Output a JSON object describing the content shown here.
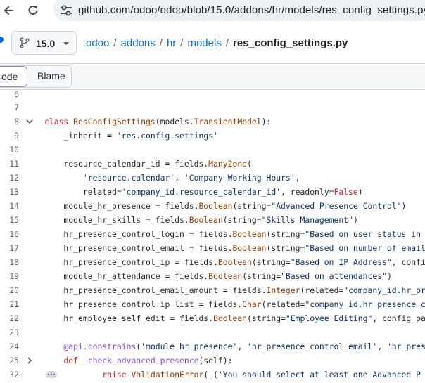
{
  "browser": {
    "url": "github.com/odoo/odoo/blob/15.0/addons/hr/models/res_config_settings.py"
  },
  "repo": {
    "branch": "15.0",
    "breadcrumb": [
      "odoo",
      "addons",
      "hr",
      "models"
    ],
    "separator": "/",
    "current_file": "res_config_settings.py"
  },
  "tabs": {
    "code": "ode",
    "blame": "Blame"
  },
  "code": {
    "lines": [
      {
        "n": "6",
        "segs": []
      },
      {
        "n": "7",
        "segs": []
      },
      {
        "n": "8",
        "segs": [
          [
            "kw",
            "class "
          ],
          [
            "cls",
            "ResConfigSettings"
          ],
          [
            "p",
            "(models."
          ],
          [
            "cls",
            "TransientModel"
          ],
          [
            "p",
            "):"
          ]
        ]
      },
      {
        "n": "9",
        "segs": [
          [
            "p",
            "    _inherit = "
          ],
          [
            "str",
            "'res.config.settings'"
          ]
        ]
      },
      {
        "n": "10",
        "segs": []
      },
      {
        "n": "11",
        "segs": [
          [
            "p",
            "    resource_calendar_id = fields."
          ],
          [
            "cls",
            "Many2one"
          ],
          [
            "p",
            "("
          ]
        ]
      },
      {
        "n": "12",
        "segs": [
          [
            "p",
            "        "
          ],
          [
            "str",
            "'resource.calendar'"
          ],
          [
            "p",
            ", "
          ],
          [
            "str",
            "'Company Working Hours'"
          ],
          [
            "p",
            ","
          ]
        ]
      },
      {
        "n": "13",
        "segs": [
          [
            "p",
            "        related="
          ],
          [
            "str",
            "'company_id.resource_calendar_id'"
          ],
          [
            "p",
            ", readonly="
          ],
          [
            "kw",
            "False"
          ],
          [
            "p",
            ")"
          ]
        ]
      },
      {
        "n": "14",
        "segs": [
          [
            "p",
            "    module_hr_presence = fields."
          ],
          [
            "cls",
            "Boolean"
          ],
          [
            "p",
            "(string="
          ],
          [
            "str",
            "\"Advanced Presence Control\""
          ],
          [
            "p",
            ")"
          ]
        ]
      },
      {
        "n": "15",
        "segs": [
          [
            "p",
            "    module_hr_skills = fields."
          ],
          [
            "cls",
            "Boolean"
          ],
          [
            "p",
            "(string="
          ],
          [
            "str",
            "\"Skills Management\""
          ],
          [
            "p",
            ")"
          ]
        ]
      },
      {
        "n": "16",
        "segs": [
          [
            "p",
            "    hr_presence_control_login = fields."
          ],
          [
            "cls",
            "Boolean"
          ],
          [
            "p",
            "(string="
          ],
          [
            "str",
            "\"Based on user status in sys"
          ]
        ]
      },
      {
        "n": "17",
        "segs": [
          [
            "p",
            "    hr_presence_control_email = fields."
          ],
          [
            "cls",
            "Boolean"
          ],
          [
            "p",
            "(string="
          ],
          [
            "str",
            "\"Based on number of emails s"
          ]
        ]
      },
      {
        "n": "18",
        "segs": [
          [
            "p",
            "    hr_presence_control_ip = fields."
          ],
          [
            "cls",
            "Boolean"
          ],
          [
            "p",
            "(string="
          ],
          [
            "str",
            "\"Based on IP Address\""
          ],
          [
            "p",
            ", config_p"
          ]
        ]
      },
      {
        "n": "19",
        "segs": [
          [
            "p",
            "    module_hr_attendance = fields."
          ],
          [
            "cls",
            "Boolean"
          ],
          [
            "p",
            "(string="
          ],
          [
            "str",
            "\"Based on attendances\""
          ],
          [
            "p",
            ")"
          ]
        ]
      },
      {
        "n": "20",
        "segs": [
          [
            "p",
            "    hr_presence_control_email_amount = fields."
          ],
          [
            "cls",
            "Integer"
          ],
          [
            "p",
            "(related="
          ],
          [
            "str",
            "\"company_id.hr_prese"
          ]
        ]
      },
      {
        "n": "21",
        "segs": [
          [
            "p",
            "    hr_presence_control_ip_list = fields."
          ],
          [
            "cls",
            "Char"
          ],
          [
            "p",
            "(related="
          ],
          [
            "str",
            "\"company_id.hr_presence_cont"
          ]
        ]
      },
      {
        "n": "22",
        "segs": [
          [
            "p",
            "    hr_employee_self_edit = fields."
          ],
          [
            "cls",
            "Boolean"
          ],
          [
            "p",
            "(string="
          ],
          [
            "str",
            "\"Employee Editing\""
          ],
          [
            "p",
            ", config_param"
          ]
        ]
      },
      {
        "n": "23",
        "segs": []
      },
      {
        "n": "24",
        "segs": [
          [
            "p",
            "    "
          ],
          [
            "dec",
            "@api.constrains"
          ],
          [
            "p",
            "("
          ],
          [
            "str",
            "'module_hr_presence'"
          ],
          [
            "p",
            ", "
          ],
          [
            "str",
            "'hr_presence_control_email'"
          ],
          [
            "p",
            ", "
          ],
          [
            "str",
            "'hr_presenc"
          ]
        ]
      },
      {
        "n": "25",
        "segs": [
          [
            "p",
            "    "
          ],
          [
            "kw",
            "def "
          ],
          [
            "dec",
            "_check_advanced_presence"
          ],
          [
            "p",
            "(self):"
          ]
        ]
      },
      {
        "n": "32",
        "segs": [
          [
            "p",
            "            "
          ],
          [
            "kw",
            "raise "
          ],
          [
            "cls",
            "ValidationError"
          ],
          [
            "p",
            "(_("
          ],
          [
            "str",
            "'You should select at least one Advanced P"
          ]
        ]
      }
    ]
  }
}
